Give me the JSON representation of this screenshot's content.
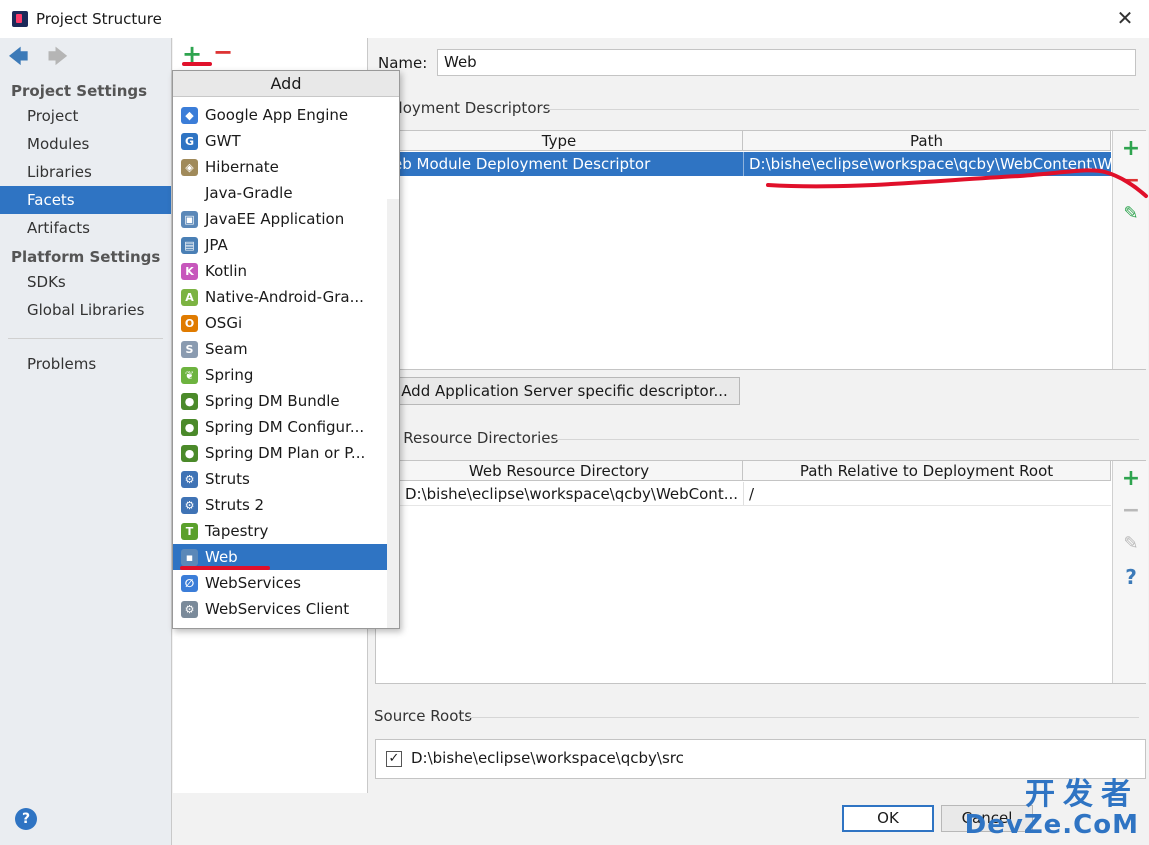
{
  "window": {
    "title": "Project Structure",
    "close_glyph": "✕"
  },
  "sidebar": {
    "back_glyph": "🡄",
    "forward_glyph": "🡆",
    "project_settings_header": "Project Settings",
    "platform_settings_header": "Platform Settings",
    "items_project": [
      {
        "label": "Project",
        "selected": false
      },
      {
        "label": "Modules",
        "selected": false
      },
      {
        "label": "Libraries",
        "selected": false
      },
      {
        "label": "Facets",
        "selected": true
      },
      {
        "label": "Artifacts",
        "selected": false
      }
    ],
    "items_platform": [
      {
        "label": "SDKs"
      },
      {
        "label": "Global Libraries"
      }
    ],
    "problems_label": "Problems",
    "help_glyph": "?"
  },
  "facets_toolbar": {
    "add_glyph": "+",
    "remove_glyph": "−"
  },
  "add_popup": {
    "title": "Add",
    "items": [
      {
        "label": "Google App Engine",
        "icon": "google-app-engine-icon",
        "color": "#3b7dd8",
        "glyph": "◆"
      },
      {
        "label": "GWT",
        "icon": "gwt-icon",
        "color": "#2f74c3",
        "glyph": "G"
      },
      {
        "label": "Hibernate",
        "icon": "hibernate-icon",
        "color": "#a08a5a",
        "glyph": "◈"
      },
      {
        "label": "Java-Gradle",
        "icon": "none",
        "color": "",
        "glyph": ""
      },
      {
        "label": "JavaEE Application",
        "icon": "javaee-icon",
        "color": "#5b88b8",
        "glyph": "▣"
      },
      {
        "label": "JPA",
        "icon": "jpa-icon",
        "color": "#4a7fb5",
        "glyph": "▤"
      },
      {
        "label": "Kotlin",
        "icon": "kotlin-icon",
        "color": "#c757bc",
        "glyph": "K"
      },
      {
        "label": "Native-Android-Gra...",
        "icon": "android-icon",
        "color": "#7cb342",
        "glyph": "A"
      },
      {
        "label": "OSGi",
        "icon": "osgi-icon",
        "color": "#e07b00",
        "glyph": "O"
      },
      {
        "label": "Seam",
        "icon": "seam-icon",
        "color": "#8a9bb0",
        "glyph": "S"
      },
      {
        "label": "Spring",
        "icon": "spring-leaf-icon",
        "color": "#6db33f",
        "glyph": "❦"
      },
      {
        "label": "Spring DM Bundle",
        "icon": "spring-dm-icon",
        "color": "#4b8a2a",
        "glyph": "●"
      },
      {
        "label": "Spring DM Configur...",
        "icon": "spring-dm-icon",
        "color": "#4b8a2a",
        "glyph": "●"
      },
      {
        "label": "Spring DM Plan or P...",
        "icon": "spring-dm-icon",
        "color": "#4b8a2a",
        "glyph": "●"
      },
      {
        "label": "Struts",
        "icon": "struts-gear-icon",
        "color": "#3f73b5",
        "glyph": "⚙"
      },
      {
        "label": "Struts 2",
        "icon": "struts-gear-icon",
        "color": "#3f73b5",
        "glyph": "⚙"
      },
      {
        "label": "Tapestry",
        "icon": "tapestry-icon",
        "color": "#5aa02c",
        "glyph": "T"
      },
      {
        "label": "Web",
        "icon": "web-module-icon",
        "color": "#5b88b8",
        "glyph": "▪",
        "selected": true
      },
      {
        "label": "WebServices",
        "icon": "webservices-icon",
        "color": "#3b7dd8",
        "glyph": "∅"
      },
      {
        "label": "WebServices Client",
        "icon": "webservices-client-icon",
        "color": "#7a8a9a",
        "glyph": "⚙"
      }
    ]
  },
  "facet_detail": {
    "name_label": "Name:",
    "name_value": "Web",
    "deployment_descriptors_title": "ployment Descriptors",
    "dd_columns": {
      "type": "Type",
      "path": "Path"
    },
    "dd_rows": [
      {
        "type": "eb Module Deployment Descriptor",
        "path": "D:\\bishe\\eclipse\\workspace\\qcby\\WebContent\\W"
      }
    ],
    "add_server_descriptor_button": "Add Application Server specific descriptor...",
    "web_resource_title": "b Resource Directories",
    "wr_columns": {
      "dir": "Web Resource Directory",
      "rel": "Path Relative to Deployment Root"
    },
    "wr_rows": [
      {
        "dir": "D:\\bishe\\eclipse\\workspace\\qcby\\WebCont...",
        "rel": "/"
      }
    ],
    "source_roots_title": "Source Roots",
    "source_roots": [
      {
        "path": "D:\\bishe\\eclipse\\workspace\\qcby\\src",
        "checked": true
      }
    ],
    "tool_glyphs": {
      "add": "+",
      "remove": "−",
      "edit": "✎",
      "help": "?"
    }
  },
  "buttons": {
    "ok": "OK",
    "cancel": "Cancel"
  },
  "watermark": {
    "line1": "开发者",
    "line2": "DevZe.CoM"
  },
  "colors": {
    "accent": "#2f74c3",
    "annotation": "#e0102a",
    "add_green": "#2ea44f"
  }
}
